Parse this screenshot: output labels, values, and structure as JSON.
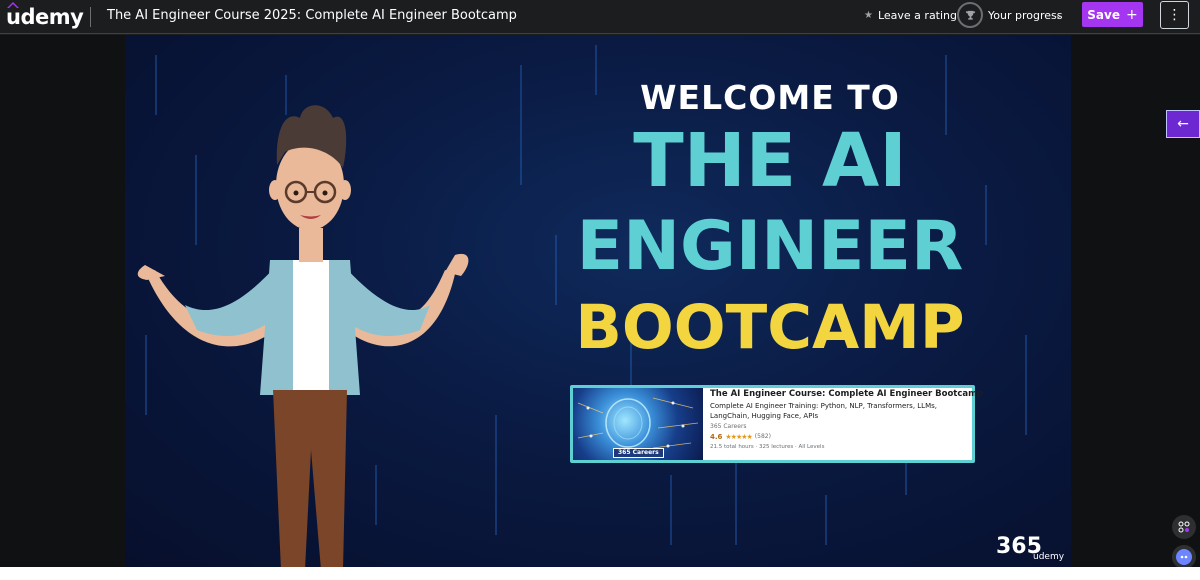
{
  "header": {
    "logo": "udemy",
    "course_title": "The AI Engineer Course 2025: Complete AI Engineer Bootcamp",
    "rating_label": "Leave a rating",
    "progress_label": "Your progress",
    "save_label": "Save",
    "save_icon": "+",
    "more_icon": "⋮"
  },
  "video": {
    "welcome": "WELCOME TO",
    "line1": "THE AI",
    "line2": "ENGINEER",
    "line3": "BOOTCAMP",
    "card": {
      "title": "The AI Engineer Course: Complete AI Engineer Bootcamp",
      "subtitle": "Complete AI Engineer Training: Python, NLP, Transformers, LLMs, LangChain, Hugging Face, APIs",
      "author": "365 Careers",
      "rating": "4.6",
      "stars": "★★★★★",
      "reviews": "(582)",
      "meta": "21.5 total hours · 325 lectures · All Levels",
      "thumb_brand": "365 Careers"
    },
    "watermark": "365",
    "watermark_sub": "udemy"
  },
  "sidebar_toggle_icon": "←",
  "colors": {
    "accent": "#a435f0",
    "teal": "#5ed0d3",
    "yellow": "#f2d53f",
    "bg": "#1c1d1f"
  }
}
